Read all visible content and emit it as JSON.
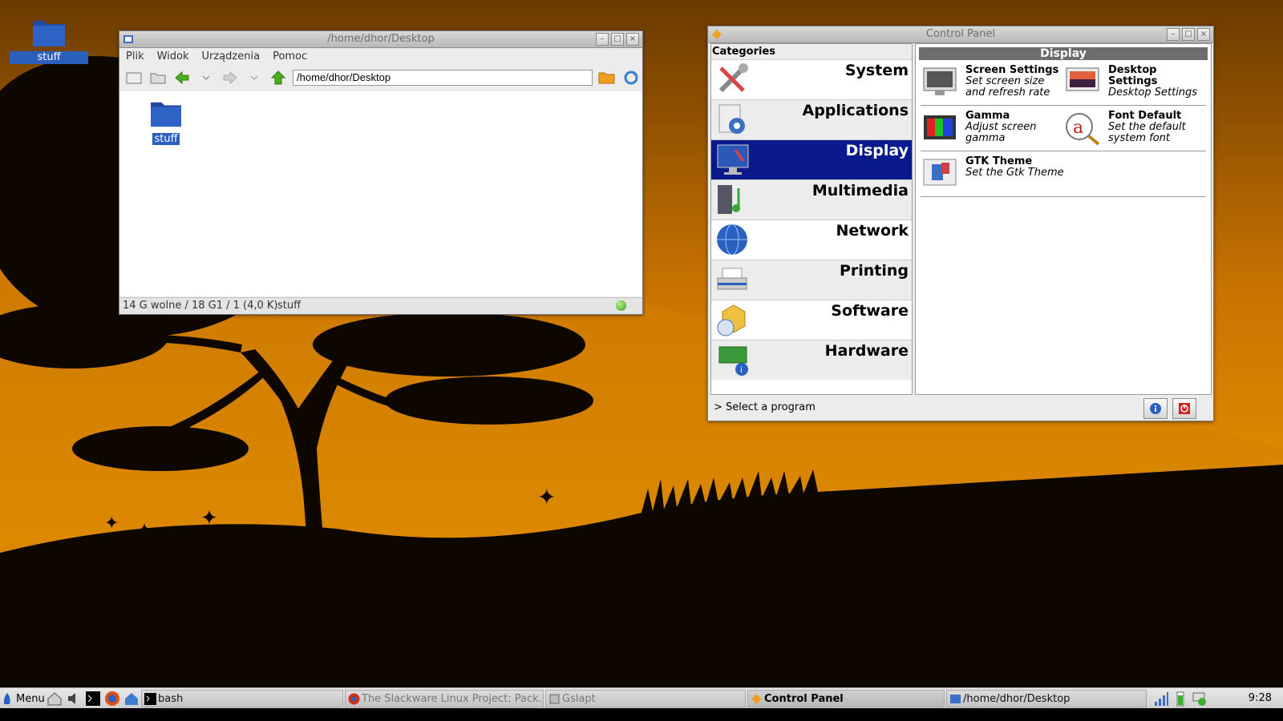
{
  "desktop": {
    "icon_label": "stuff"
  },
  "file_manager": {
    "title": "/home/dhor/Desktop",
    "menu": [
      "Plik",
      "Widok",
      "Urządzenia",
      "Pomoc"
    ],
    "address": "/home/dhor/Desktop",
    "files": [
      {
        "name": "stuff",
        "icon": "folder-icon"
      }
    ],
    "status_space": "14 G wolne / 18 G1 / 1 (4,0 K)",
    "status_selected": "stuff"
  },
  "control_panel": {
    "title": "Control Panel",
    "categories_header": "Categories",
    "categories": [
      {
        "label": "System",
        "icon": "tools-icon"
      },
      {
        "label": "Applications",
        "icon": "applications-icon"
      },
      {
        "label": "Display",
        "icon": "display-icon",
        "active": true
      },
      {
        "label": "Multimedia",
        "icon": "multimedia-icon"
      },
      {
        "label": "Network",
        "icon": "globe-icon"
      },
      {
        "label": "Printing",
        "icon": "printer-icon"
      },
      {
        "label": "Software",
        "icon": "software-icon"
      },
      {
        "label": "Hardware",
        "icon": "hardware-icon"
      }
    ],
    "section_title": "Display",
    "programs": [
      {
        "name": "Screen Settings",
        "desc": "Set screen size and refresh rate",
        "icon": "monitor-icon"
      },
      {
        "name": "Desktop Settings",
        "desc": "Desktop Settings",
        "icon": "desktop-image-icon"
      },
      {
        "name": "Gamma",
        "desc": "Adjust screen gamma",
        "icon": "gamma-icon"
      },
      {
        "name": "Font Default",
        "desc": "Set the default system font",
        "icon": "font-icon"
      },
      {
        "name": "GTK Theme",
        "desc": "Set the Gtk Theme",
        "icon": "theme-icon"
      }
    ],
    "status": "> Select a program"
  },
  "taskbar": {
    "menu_label": "Menu",
    "tasks": [
      {
        "label": "bash"
      },
      {
        "label": "The Slackware Linux Project: Pack..."
      },
      {
        "label": "Gslapt"
      },
      {
        "label": "Control Panel"
      },
      {
        "label": "/home/dhor/Desktop"
      }
    ],
    "clock": "9:28"
  },
  "colors": {
    "accent": "#0a1a8c",
    "selection": "#2a5fbd",
    "sky": "#e08a00"
  }
}
